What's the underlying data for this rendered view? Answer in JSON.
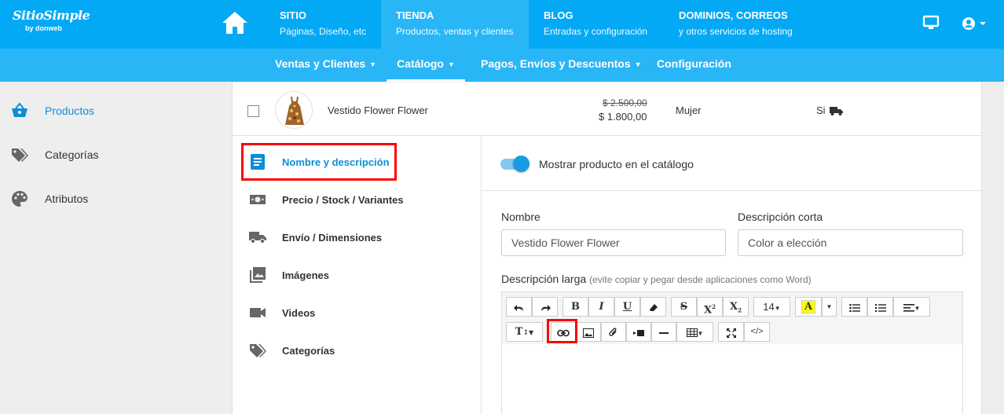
{
  "brand": {
    "name": "SitioSimple",
    "by": "by donweb"
  },
  "topnav": [
    {
      "title": "SITIO",
      "subtitle": "Páginas, Diseño, etc"
    },
    {
      "title": "TIENDA",
      "subtitle": "Productos, ventas y clientes"
    },
    {
      "title": "BLOG",
      "subtitle": "Entradas y configuración"
    },
    {
      "title": "DOMINIOS, CORREOS",
      "subtitle": "y otros servicios de hosting"
    }
  ],
  "subnav": [
    {
      "label": "Ventas y Clientes",
      "has_caret": true
    },
    {
      "label": "Catálogo",
      "has_caret": true
    },
    {
      "label": "Pagos, Envíos y Descuentos",
      "has_caret": true
    },
    {
      "label": "Configuración",
      "has_caret": false
    }
  ],
  "sidebar": [
    {
      "label": "Productos",
      "icon": "basket-icon",
      "active": true
    },
    {
      "label": "Categorías",
      "icon": "tags-icon"
    },
    {
      "label": "Atributos",
      "icon": "palette-icon"
    }
  ],
  "product": {
    "name": "Vestido Flower Flower",
    "old_price": "$ 2.500,00",
    "price": "$ 1.800,00",
    "category": "Mujer",
    "shipping": "Si"
  },
  "edit_menu": [
    {
      "label": "Nombre y descripción",
      "icon": "description-icon",
      "active": true
    },
    {
      "label": "Precio / Stock / Variantes",
      "icon": "money-icon"
    },
    {
      "label": "Envío / Dimensiones",
      "icon": "truck-icon"
    },
    {
      "label": "Imágenes",
      "icon": "images-icon"
    },
    {
      "label": "Videos",
      "icon": "video-icon"
    },
    {
      "label": "Categorías",
      "icon": "tags-icon"
    }
  ],
  "form": {
    "show_in_catalog_label": "Mostrar producto en el catálogo",
    "show_in_catalog": true,
    "name_label": "Nombre",
    "name_value": "Vestido Flower Flower",
    "short_desc_label": "Descripción corta",
    "short_desc_value": "Color a elección",
    "long_desc_label": "Descripción larga",
    "long_desc_hint": "(evite copiar y pegar desde aplicaciones como Word)",
    "font_size": "14"
  },
  "colors": {
    "primary": "#03a9f4",
    "subnav": "#29b6f6",
    "accent": "#0d8ed8",
    "highlight": "#ff0000"
  }
}
